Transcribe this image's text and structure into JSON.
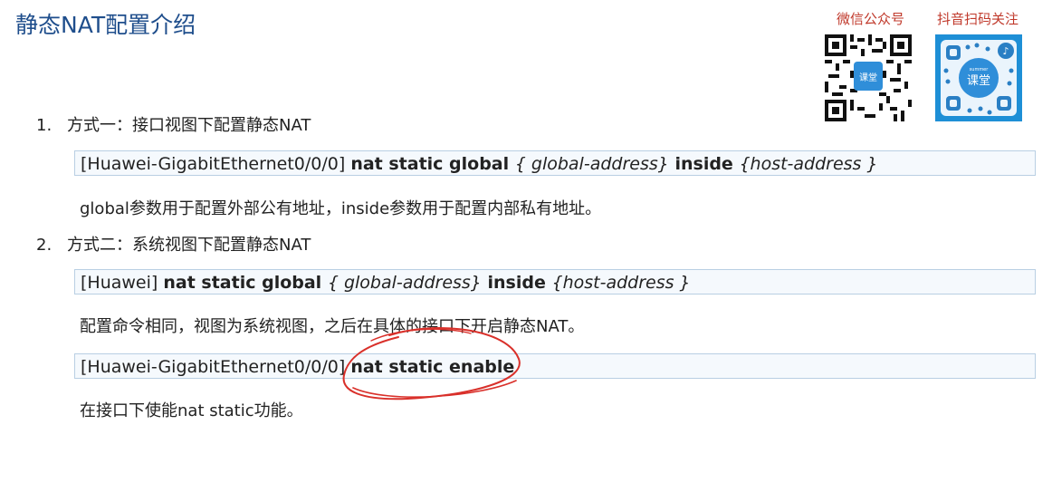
{
  "title": "静态NAT配置介绍",
  "qr": {
    "wechat_label": "微信公众号",
    "douyin_label": "抖音扫码关注",
    "badge_text": "课堂",
    "badge_small": "summer"
  },
  "steps": [
    {
      "num": "1.",
      "text": "方式一：接口视图下配置静态NAT"
    },
    {
      "num": "2.",
      "text": "方式二：系统视图下配置静态NAT"
    }
  ],
  "cmd1": {
    "prefix": "[Huawei-GigabitEthernet0/0/0] ",
    "kw1": "nat static  global ",
    "arg1": "{ global-address}",
    "kw2": " inside ",
    "arg2": "{host-address }"
  },
  "desc1": "global参数用于配置外部公有地址，inside参数用于配置内部私有地址。",
  "cmd2": {
    "prefix": "[Huawei] ",
    "kw1": "nat static  global ",
    "arg1": "{ global-address}",
    "kw2": " inside ",
    "arg2": "{host-address }"
  },
  "desc2": "配置命令相同，视图为系统视图，之后在具体的接口下开启静态NAT。",
  "cmd3": {
    "prefix": "[Huawei-GigabitEthernet0/0/0] ",
    "kw1": "nat static enable"
  },
  "desc3": "在接口下使能nat static功能。",
  "colors": {
    "title": "#1f4e8c",
    "qr_label": "#c0392b",
    "annotation": "#d9302a",
    "cmd_bg": "#f5f9fd",
    "cmd_border": "#b9cfe3"
  }
}
